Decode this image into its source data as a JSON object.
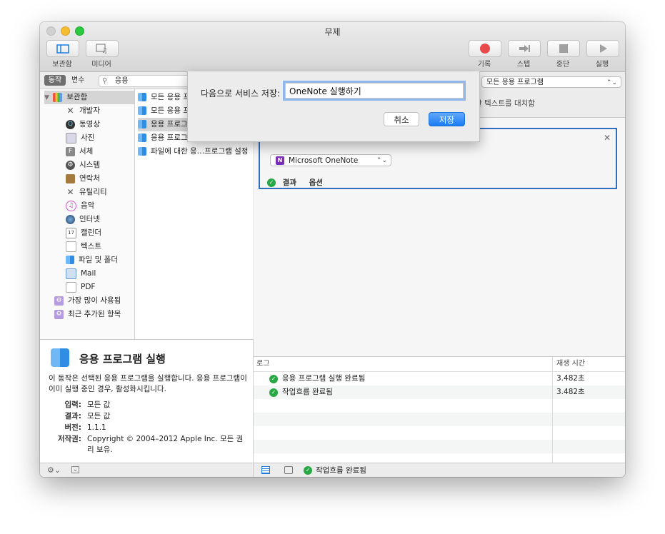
{
  "window": {
    "title": "무제"
  },
  "toolbar": {
    "left": [
      {
        "label": "보관함",
        "icon": "library-panel-icon"
      },
      {
        "label": "미디어",
        "icon": "media-icon"
      }
    ],
    "right": [
      {
        "label": "기록",
        "icon": "record-icon"
      },
      {
        "label": "스텝",
        "icon": "step-icon"
      },
      {
        "label": "중단",
        "icon": "stop-icon"
      },
      {
        "label": "실행",
        "icon": "run-icon"
      }
    ]
  },
  "library": {
    "tab_actions": "동작",
    "tab_variables": "변수",
    "search_value": "응용",
    "root": "보관함",
    "items": [
      {
        "label": "개발자",
        "icon": "developer-icon"
      },
      {
        "label": "동영상",
        "icon": "movie-icon"
      },
      {
        "label": "사진",
        "icon": "photo-icon"
      },
      {
        "label": "서체",
        "icon": "font-icon"
      },
      {
        "label": "시스템",
        "icon": "system-icon"
      },
      {
        "label": "연락처",
        "icon": "contacts-icon"
      },
      {
        "label": "유틸리티",
        "icon": "utility-icon"
      },
      {
        "label": "음악",
        "icon": "music-icon"
      },
      {
        "label": "인터넷",
        "icon": "internet-icon"
      },
      {
        "label": "캘린더",
        "icon": "calendar-icon"
      },
      {
        "label": "텍스트",
        "icon": "text-icon"
      },
      {
        "label": "파일 및 폴더",
        "icon": "finder-icon"
      },
      {
        "label": "Mail",
        "icon": "mail-icon"
      },
      {
        "label": "PDF",
        "icon": "pdf-icon"
      }
    ],
    "smart_groups": [
      {
        "label": "가장 많이 사용됨",
        "icon": "smart-folder-icon"
      },
      {
        "label": "최근 추가된 항목",
        "icon": "smart-folder-icon"
      }
    ]
  },
  "actions": [
    {
      "label": "모든 응용 프"
    },
    {
      "label": "모든 응용 프"
    },
    {
      "label": "응용 프로그"
    },
    {
      "label": "응용 프로그"
    },
    {
      "label": "파일에 대한 응…프로그램 설정"
    }
  ],
  "description": {
    "title": "응용 프로그램 실행",
    "text": "이 동작은 선택된 응용 프로그램을 실행합니다. 응용 프로그램이 이미 실행 중인 경우, 활성화시킵니다.",
    "input_label": "입력:",
    "input_value": "모든 값",
    "result_label": "결과:",
    "result_value": "모든 값",
    "version_label": "버전:",
    "version_value": "1.1.1",
    "copyright_label": "저작권:",
    "copyright_value": "Copyright © 2004–2012 Apple Inc.  모든 권리 보유."
  },
  "service": {
    "input_popup": "모든 응용 프로그램",
    "replace_text": "한 텍스트를 대치함"
  },
  "action_card": {
    "app_select": "Microsoft OneNote",
    "results_tab": "결과",
    "options_tab": "옵션"
  },
  "log": {
    "col_log": "로그",
    "col_duration": "재생 시간",
    "rows": [
      {
        "text": "응용 프로그램 실행 완료됨",
        "duration": "3.482초"
      },
      {
        "text": "작업흐름 완료됨",
        "duration": "3.482초"
      }
    ]
  },
  "status": {
    "text": "작업흐름 완료됨"
  },
  "save_sheet": {
    "label": "다음으로 서비스 저장:",
    "value": "OneNote 실행하기",
    "cancel": "취소",
    "save": "저장"
  },
  "colors": {
    "accent": "#2f6fbf",
    "save_button": "#1a7cf5",
    "success": "#27a844"
  }
}
